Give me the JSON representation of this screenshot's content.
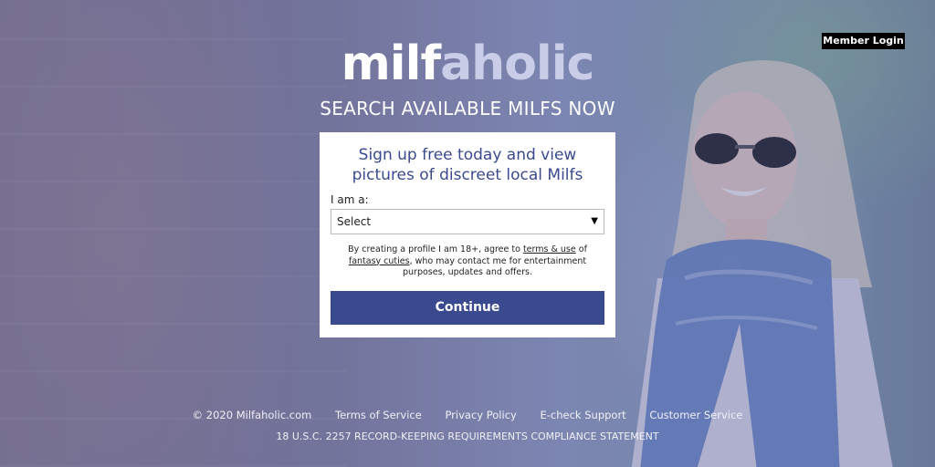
{
  "header": {
    "member_login_label": "Member Login",
    "logo_part1": "milf",
    "logo_part2": "aholic",
    "tagline": "SEARCH AVAILABLE MILFS NOW"
  },
  "signup": {
    "heading": "Sign up free today and view pictures of discreet local Milfs",
    "iam_label": "I am a:",
    "select_value": "Select",
    "disclaimer_pre": "By creating a profile I am 18+, agree to ",
    "terms_link": "terms & use",
    "disclaimer_mid": " of ",
    "fantasy_link": "fantasy cuties",
    "disclaimer_post": ", who may contact me for entertainment purposes, updates and offers.",
    "continue_label": "Continue"
  },
  "footer": {
    "copyright": "© 2020 Milfaholic.com",
    "links": [
      "Terms of Service",
      "Privacy Policy",
      "E-check Support",
      "Customer Service"
    ],
    "compliance": "18 U.S.C. 2257 RECORD-KEEPING REQUIREMENTS COMPLIANCE STATEMENT"
  },
  "colors": {
    "brand_blue": "#3b4a8e",
    "overlay": "#464b8c"
  },
  "icons": {
    "select_caret": "caret-down-icon"
  }
}
